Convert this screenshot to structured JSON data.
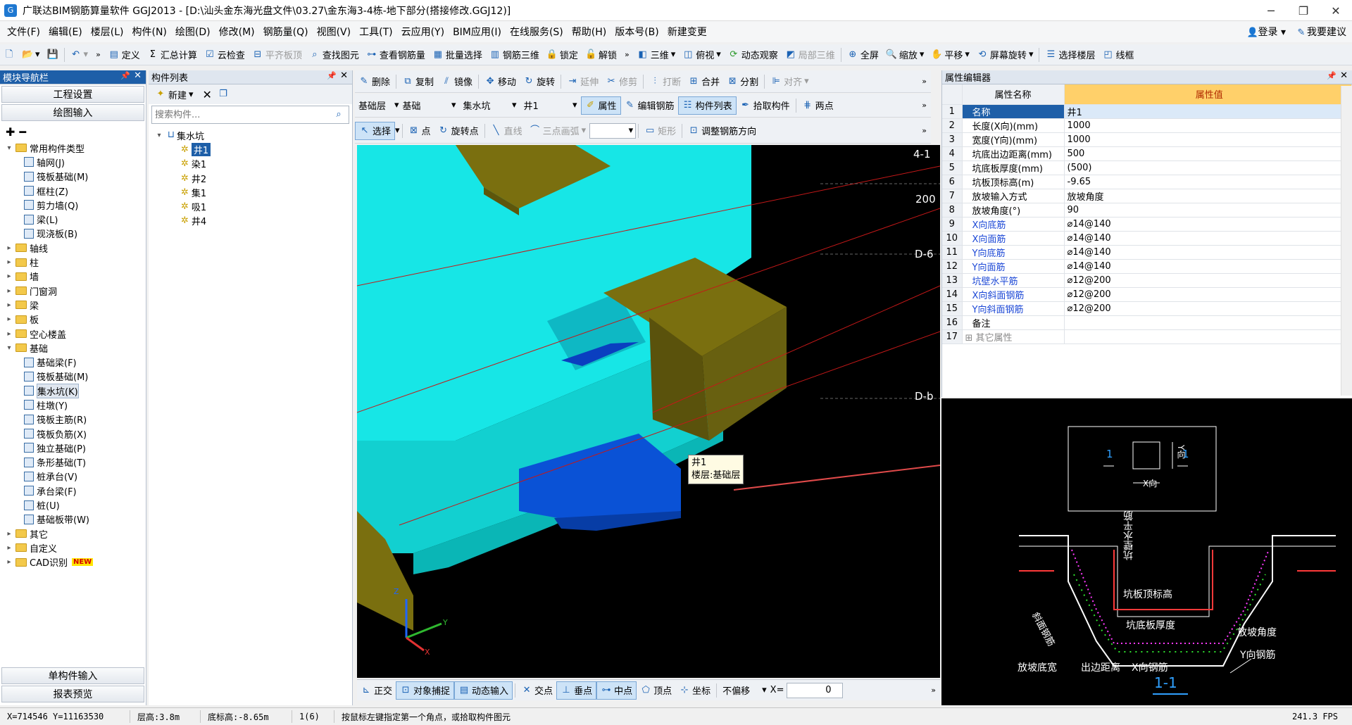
{
  "window": {
    "title": "广联达BIM钢筋算量软件 GGJ2013 - [D:\\汕头金东海光盘文件\\03.27\\金东海3-4栋-地下部分(搭接修改.GGJ12)]",
    "minimize": "─",
    "maximize": "❐",
    "close": "✕"
  },
  "menu": {
    "items": [
      "文件(F)",
      "编辑(E)",
      "楼层(L)",
      "构件(N)",
      "绘图(D)",
      "修改(M)",
      "钢筋量(Q)",
      "视图(V)",
      "工具(T)",
      "云应用(Y)",
      "BIM应用(I)",
      "在线服务(S)",
      "帮助(H)",
      "版本号(B)",
      "新建变更"
    ],
    "login": "登录",
    "suggest": "我要建议"
  },
  "toolbar1": {
    "define": "定义",
    "sum": "汇总计算",
    "cloud_check": "云检查",
    "flat_top": "平齐板顶",
    "find_element": "查找图元",
    "view_rebar": "查看钢筋量",
    "batch_select": "批量选择",
    "rebar_3d": "钢筋三维",
    "lock": "锁定",
    "unlock": "解锁",
    "three_d": "三维",
    "top_view": "俯视",
    "dynamic_view": "动态观察",
    "local_3d": "局部三维",
    "fullscreen": "全屏",
    "zoom": "缩放",
    "pan": "平移",
    "screen_rotate": "屏幕旋转",
    "select_floor": "选择楼层",
    "wireframe": "线框"
  },
  "left_nav": {
    "title": "模块导航栏",
    "project_settings": "工程设置",
    "drawing_input": "绘图输入",
    "tree": [
      {
        "label": "常用构件类型",
        "level": 0,
        "expanded": true
      },
      {
        "label": "轴网(J)",
        "level": 1
      },
      {
        "label": "筏板基础(M)",
        "level": 1
      },
      {
        "label": "框柱(Z)",
        "level": 1
      },
      {
        "label": "剪力墙(Q)",
        "level": 1
      },
      {
        "label": "梁(L)",
        "level": 1
      },
      {
        "label": "现浇板(B)",
        "level": 1
      },
      {
        "label": "轴线",
        "level": 0
      },
      {
        "label": "柱",
        "level": 0
      },
      {
        "label": "墙",
        "level": 0
      },
      {
        "label": "门窗洞",
        "level": 0
      },
      {
        "label": "梁",
        "level": 0
      },
      {
        "label": "板",
        "level": 0
      },
      {
        "label": "空心楼盖",
        "level": 0
      },
      {
        "label": "基础",
        "level": 0,
        "expanded": true
      },
      {
        "label": "基础梁(F)",
        "level": 1
      },
      {
        "label": "筏板基础(M)",
        "level": 1
      },
      {
        "label": "集水坑(K)",
        "level": 1,
        "selected": true
      },
      {
        "label": "柱墩(Y)",
        "level": 1
      },
      {
        "label": "筏板主筋(R)",
        "level": 1
      },
      {
        "label": "筏板负筋(X)",
        "level": 1
      },
      {
        "label": "独立基础(P)",
        "level": 1
      },
      {
        "label": "条形基础(T)",
        "level": 1
      },
      {
        "label": "桩承台(V)",
        "level": 1
      },
      {
        "label": "承台梁(F)",
        "level": 1
      },
      {
        "label": "桩(U)",
        "level": 1
      },
      {
        "label": "基础板带(W)",
        "level": 1
      },
      {
        "label": "其它",
        "level": 0
      },
      {
        "label": "自定义",
        "level": 0
      },
      {
        "label": "CAD识别",
        "level": 0,
        "badge": "NEW"
      }
    ],
    "single_input": "单构件输入",
    "report_preview": "报表预览"
  },
  "component_list": {
    "title": "构件列表",
    "new": "新建",
    "search_placeholder": "搜索构件...",
    "root": "集水坑",
    "items": [
      "井1",
      "染1",
      "井2",
      "集1",
      "吸1",
      "井4"
    ]
  },
  "toolbar2": {
    "delete": "删除",
    "copy": "复制",
    "mirror": "镜像",
    "move": "移动",
    "rotate": "旋转",
    "extend": "延伸",
    "trim": "修剪",
    "break": "打断",
    "merge": "合并",
    "split": "分割",
    "align": "对齐"
  },
  "toolbar3": {
    "floor": "基础层",
    "category": "基础",
    "type": "集水坑",
    "element": "井1",
    "property": "属性",
    "edit_rebar": "编辑钢筋",
    "comp_list": "构件列表",
    "pick": "拾取构件",
    "two_points": "两点"
  },
  "toolbar4": {
    "select": "选择",
    "point": "点",
    "rotate_point": "旋转点",
    "line": "直线",
    "three_point_arc": "三点画弧",
    "rect": "矩形",
    "adjust_rebar": "调整钢筋方向"
  },
  "viewport": {
    "label_4_1": "4-1",
    "label_200": "200",
    "label_d6": "D-6",
    "label_db": "D-b",
    "tooltip_name": "井1",
    "tooltip_floor": "楼层:基础层",
    "axis_z": "Z",
    "axis_y": "Y",
    "axis_x": "X",
    "colors": {
      "slab": "#17e6e6",
      "beam": "#7a6f0f",
      "pit": "#0a52d6",
      "bg": "#000000",
      "gridline": "#c41818"
    }
  },
  "bottom_toolbar": {
    "ortho": "正交",
    "snap": "对象捕捉",
    "dynamic_input": "动态输入",
    "intersection": "交点",
    "perpendicular": "垂点",
    "midpoint": "中点",
    "vertex": "顶点",
    "coordinate": "坐标",
    "offset": "不偏移",
    "x_label": "X=",
    "x_value": "0"
  },
  "properties": {
    "title": "属性编辑器",
    "col_name": "属性名称",
    "col_value": "属性值",
    "rows": [
      {
        "n": "1",
        "name": "名称",
        "value": "井1",
        "blue": false
      },
      {
        "n": "2",
        "name": "长度(X向)(mm)",
        "value": "1000",
        "blue": false
      },
      {
        "n": "3",
        "name": "宽度(Y向)(mm)",
        "value": "1000",
        "blue": false
      },
      {
        "n": "4",
        "name": "坑底出边距离(mm)",
        "value": "500",
        "blue": false
      },
      {
        "n": "5",
        "name": "坑底板厚度(mm)",
        "value": "(500)",
        "blue": false
      },
      {
        "n": "6",
        "name": "坑板顶标高(m)",
        "value": "-9.65",
        "blue": false
      },
      {
        "n": "7",
        "name": "放坡输入方式",
        "value": "放坡角度",
        "blue": false
      },
      {
        "n": "8",
        "name": "放坡角度(°)",
        "value": "90",
        "blue": false
      },
      {
        "n": "9",
        "name": "X向底筋",
        "value": "⌀14@140",
        "blue": true
      },
      {
        "n": "10",
        "name": "X向面筋",
        "value": "⌀14@140",
        "blue": true
      },
      {
        "n": "11",
        "name": "Y向底筋",
        "value": "⌀14@140",
        "blue": true
      },
      {
        "n": "12",
        "name": "Y向面筋",
        "value": "⌀14@140",
        "blue": true
      },
      {
        "n": "13",
        "name": "坑壁水平筋",
        "value": "⌀12@200",
        "blue": true
      },
      {
        "n": "14",
        "name": "X向斜面钢筋",
        "value": "⌀12@200",
        "blue": true
      },
      {
        "n": "15",
        "name": "Y向斜面钢筋",
        "value": "⌀12@200",
        "blue": true
      },
      {
        "n": "16",
        "name": "备注",
        "value": "",
        "blue": false
      },
      {
        "n": "17",
        "name": "其它属性",
        "value": "",
        "blue": false,
        "group": true
      }
    ]
  },
  "diagram": {
    "x_dir": "X向",
    "y_dir": "Y向",
    "section_mark": "1",
    "wall_horiz": "坑壁水平筋",
    "top_elev": "坑板顶标高",
    "bottom_thick": "坑底板厚度",
    "slope_angle": "放坡角度",
    "slope_rebar": "斜面钢筋",
    "slope_bottom_width": "放坡底宽",
    "edge_dist": "出边距离",
    "x_rebar": "X向钢筋",
    "y_rebar": "Y向钢筋",
    "section_label": "1-1"
  },
  "status": {
    "coords": "X=714546 Y=11163530",
    "floor_height": "层高:3.8m",
    "bottom_elev": "底标高:-8.65m",
    "count": "1(6)",
    "hint": "按鼠标左键指定第一个角点，或拾取构件图元",
    "fps": "241.3 FPS"
  }
}
